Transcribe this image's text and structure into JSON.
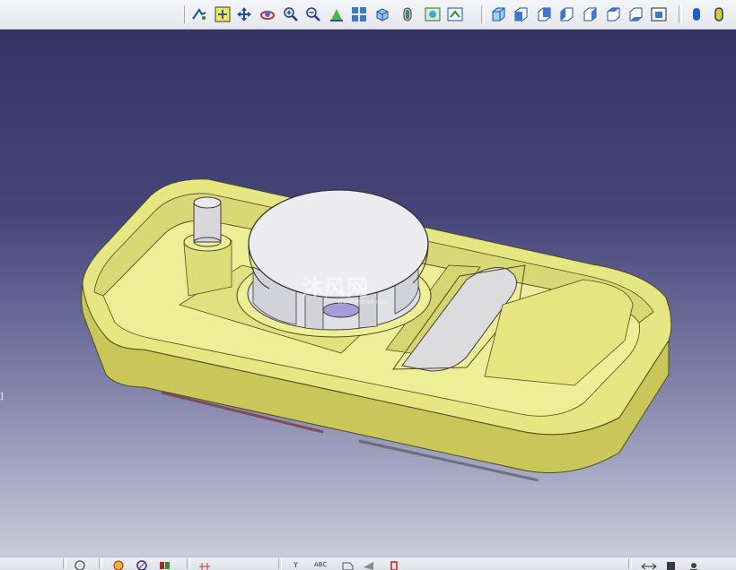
{
  "toolbar": {
    "view_tools": [
      {
        "icon": "fly-mode-icon"
      },
      {
        "icon": "fit-all-icon"
      },
      {
        "icon": "pan-icon"
      },
      {
        "icon": "rotate-icon"
      },
      {
        "icon": "zoom-in-icon"
      },
      {
        "icon": "zoom-out-icon"
      },
      {
        "icon": "normal-view-icon"
      },
      {
        "icon": "multi-view-icon"
      },
      {
        "icon": "isometric-view-icon"
      },
      {
        "icon": "render-style-icon"
      },
      {
        "icon": "hide-show-icon"
      },
      {
        "icon": "swap-space-icon"
      }
    ],
    "cube_views": [
      {
        "icon": "view-iso-icon"
      },
      {
        "icon": "view-front-icon"
      },
      {
        "icon": "view-back-icon"
      },
      {
        "icon": "view-left-icon"
      },
      {
        "icon": "view-right-icon"
      },
      {
        "icon": "view-top-icon"
      },
      {
        "icon": "view-bottom-icon"
      },
      {
        "icon": "named-views-icon"
      }
    ],
    "render_modes": [
      {
        "icon": "shading-icon"
      },
      {
        "icon": "shading-edges-icon"
      }
    ]
  },
  "viewport": {
    "left_tab_label": "]",
    "watermark": {
      "title": "沐风网",
      "url": "www.mfcad.com"
    },
    "colors": {
      "housing": "#e6e682",
      "housing_shade": "#c9c75a",
      "fan_disc": "#e8e8ec",
      "background_top": "#343465",
      "background_bottom": "#c9ccdb"
    }
  },
  "bottom_toolbar": {
    "items": [
      {
        "icon": "snap-icon"
      },
      {
        "icon": "sketch-icon"
      },
      {
        "icon": "constraint-icon"
      },
      {
        "icon": "material-icon"
      },
      {
        "icon": "axis-icon"
      },
      {
        "label": "Y",
        "icon": "axis-y-icon"
      },
      {
        "label": "ABC",
        "icon": "text-icon"
      },
      {
        "icon": "annotation-icon"
      },
      {
        "icon": "flag-icon"
      },
      {
        "icon": "measure-icon"
      },
      {
        "icon": "apply-material-icon"
      },
      {
        "icon": "user-icon"
      }
    ]
  }
}
